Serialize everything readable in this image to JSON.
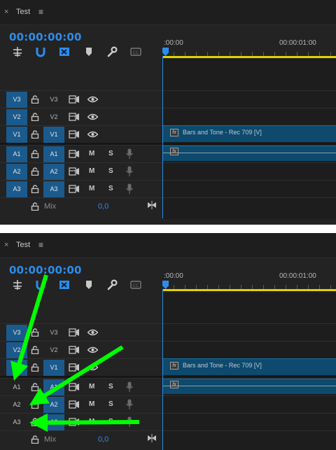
{
  "panels": [
    {
      "tab": {
        "close_glyph": "×",
        "title": "Test",
        "menu_glyph": "≡"
      },
      "timecode": "00:00:00:00",
      "ruler": {
        "start_label": ":00:00",
        "end_label": "00:00:01:00"
      },
      "video_tracks": [
        {
          "source": "V3",
          "target": "V3",
          "source_on": true,
          "target_on": false
        },
        {
          "source": "V2",
          "target": "V2",
          "source_on": true,
          "target_on": false
        },
        {
          "source": "V1",
          "target": "V1",
          "source_on": true,
          "target_on": true
        }
      ],
      "audio_tracks": [
        {
          "source": "A1",
          "target": "A1",
          "mute": "M",
          "solo": "S",
          "source_on": true,
          "target_on": true
        },
        {
          "source": "A2",
          "target": "A2",
          "mute": "M",
          "solo": "S",
          "source_on": true,
          "target_on": true
        },
        {
          "source": "A3",
          "target": "A3",
          "mute": "M",
          "solo": "S",
          "source_on": true,
          "target_on": true
        }
      ],
      "mix": {
        "label": "Mix",
        "value": "0,0"
      },
      "video_clip": {
        "fx": "fx",
        "label": "Bars and Tone - Rec 709 [V]"
      },
      "audio_clip": {
        "fx": "fx"
      }
    },
    {
      "tab": {
        "close_glyph": "×",
        "title": "Test",
        "menu_glyph": "≡"
      },
      "timecode": "00:00:00:00",
      "ruler": {
        "start_label": ":00:00",
        "end_label": "00:00:01:00"
      },
      "video_tracks": [
        {
          "source": "V3",
          "target": "V3",
          "source_on": true,
          "target_on": false
        },
        {
          "source": "V2",
          "target": "V2",
          "source_on": true,
          "target_on": false
        },
        {
          "source": "V1",
          "target": "V1",
          "source_on": true,
          "target_on": true
        }
      ],
      "audio_tracks": [
        {
          "source": "A1",
          "target": "A1",
          "mute": "M",
          "solo": "S",
          "source_on": false,
          "target_on": true
        },
        {
          "source": "A2",
          "target": "A2",
          "mute": "M",
          "solo": "S",
          "source_on": false,
          "target_on": true
        },
        {
          "source": "A3",
          "target": "A3",
          "mute": "M",
          "solo": "S",
          "source_on": false,
          "target_on": true
        }
      ],
      "mix": {
        "label": "Mix",
        "value": "0,0"
      },
      "video_clip": {
        "fx": "fx",
        "label": "Bars and Tone - Rec 709 [V]"
      },
      "audio_clip": {
        "fx": "fx"
      }
    }
  ],
  "colors": {
    "accent_blue": "#2d8ceb",
    "patch_on": "#1b5a8c",
    "clip": "#0d4a6d",
    "ruler_yellow": "#e2d100",
    "arrow_green": "#00ff00"
  },
  "icons": [
    "close-icon",
    "panel-menu-icon",
    "snap-icon",
    "magnet-icon",
    "linked-selection-icon",
    "add-marker-icon",
    "settings-wrench-icon",
    "captions-icon",
    "lock-icon",
    "sync-lock-icon",
    "eye-icon",
    "microphone-icon",
    "mix-end-icon"
  ]
}
